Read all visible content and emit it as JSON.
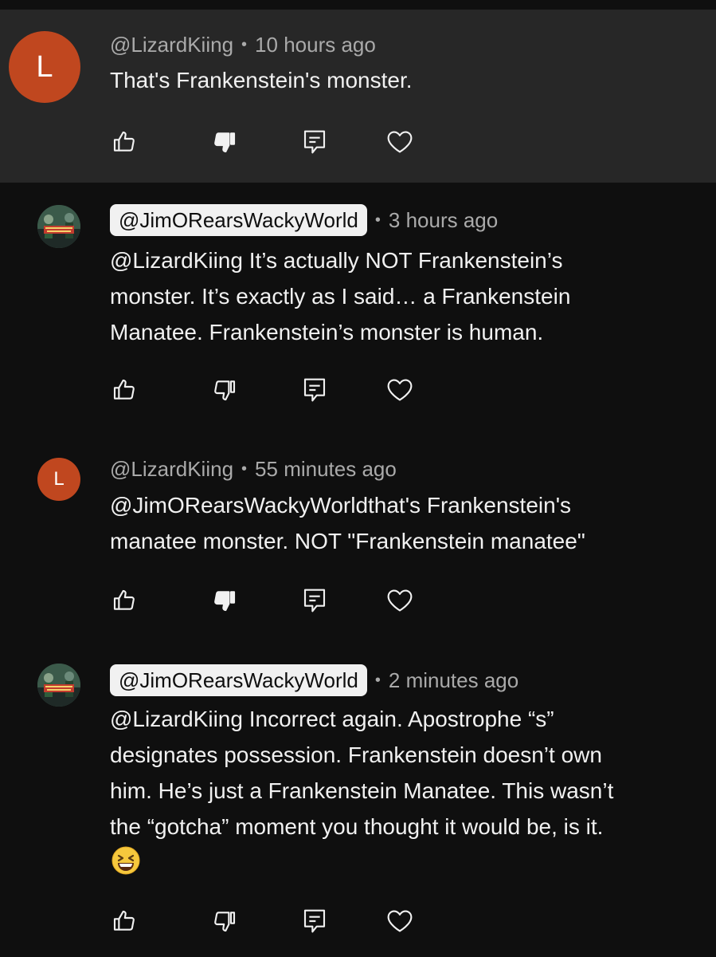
{
  "comments": [
    {
      "author": "@LizardKiing",
      "time": "10 hours ago",
      "avatar_letter": "L",
      "text": "That's Frankenstein's monster.",
      "disliked": true
    },
    {
      "author": "@JimORearsWackyWorld",
      "time": "3 hours ago",
      "avatar_label": "JIM O'REAR'S WACKY WORLD",
      "text": "@LizardKiing It’s actually NOT Frankenstein’s\nmonster. It’s exactly as I said… a Frankenstein\nManatee. Frankenstein’s monster is human.",
      "disliked": false
    },
    {
      "author": "@LizardKiing",
      "time": "55 minutes ago",
      "avatar_letter": "L",
      "text": "@JimORearsWackyWorldthat's Frankenstein's\nmanatee monster. NOT \"Frankenstein manatee\"",
      "disliked": true
    },
    {
      "author": "@JimORearsWackyWorld",
      "time": "2 minutes ago",
      "avatar_label": "JIM O'REAR'S WACKY WORLD",
      "text": "@LizardKiing Incorrect again. Apostrophe “s”\ndesignates possession. Frankenstein doesn’t own\nhim. He’s just a Frankenstein Manatee. This wasn’t\nthe “gotcha” moment you thought it would be, is it.",
      "trailing_emoji": "grinning-squinting-face-emoji",
      "disliked": false
    }
  ],
  "icons": {
    "like": "thumbs-up-icon",
    "dislike": "thumbs-down-icon",
    "reply": "reply-icon",
    "heart": "heart-icon"
  },
  "colors": {
    "background": "#0f0f0f",
    "highlight": "#272727",
    "avatar_letter_bg": "#c0471f",
    "pill_bg": "#f1f1f1",
    "text": "#f1f1f1",
    "meta": "#aaaaaa"
  },
  "separator": "•"
}
